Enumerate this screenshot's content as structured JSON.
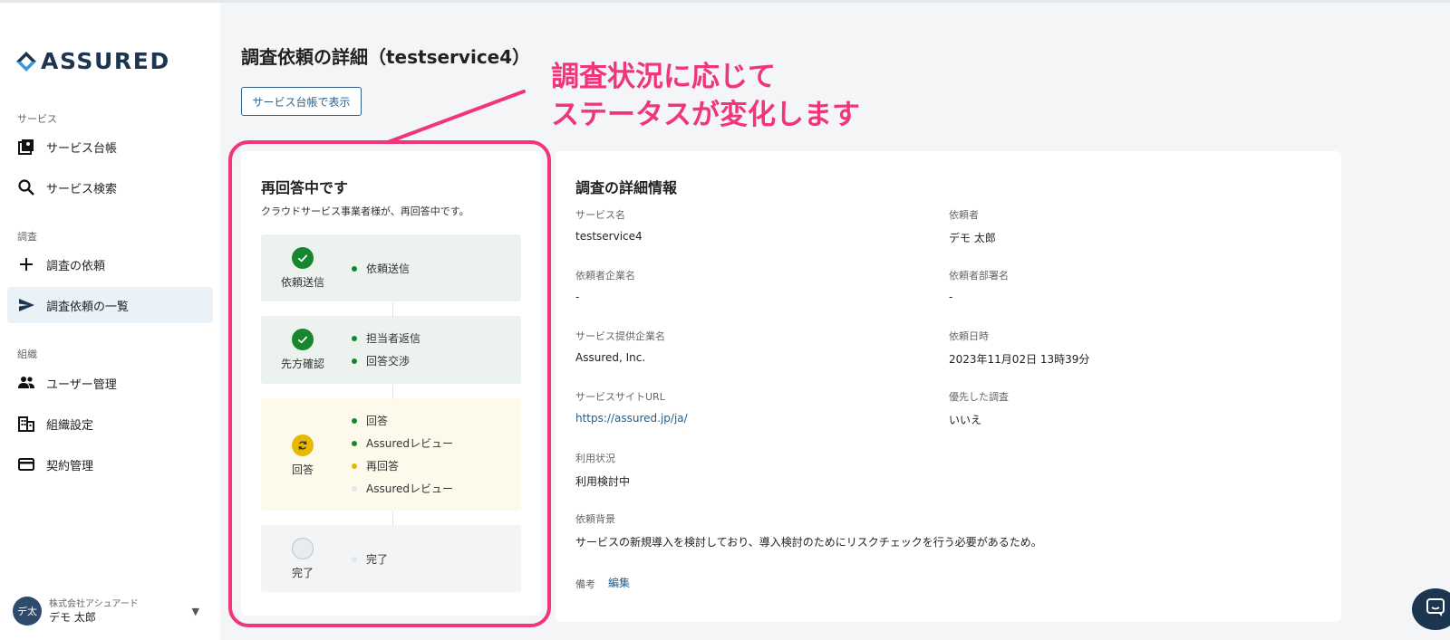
{
  "brand": {
    "logo_text": "ASSURED",
    "color": "#1c3551"
  },
  "sidebar": {
    "section_service": "サービス",
    "section_survey": "調査",
    "section_org": "組織",
    "items": [
      {
        "label": "サービス台帳",
        "icon": "service-ledger-icon"
      },
      {
        "label": "サービス検索",
        "icon": "search-icon"
      },
      {
        "label": "調査の依頼",
        "icon": "plus-icon"
      },
      {
        "label": "調査依頼の一覧",
        "icon": "send-icon",
        "active": true
      },
      {
        "label": "ユーザー管理",
        "icon": "users-icon"
      },
      {
        "label": "組織設定",
        "icon": "building-icon"
      },
      {
        "label": "契約管理",
        "icon": "credit-card-icon"
      }
    ],
    "user": {
      "avatar": "デ太",
      "company": "株式会社アシュアード",
      "name": "デモ 太郎"
    }
  },
  "main": {
    "title": "調査依頼の詳細（testservice4）",
    "ledger_button": "サービス台帳で表示"
  },
  "annotation": {
    "line1": "調査状況に応じて",
    "line2": "ステータスが変化します",
    "color": "#f0357a"
  },
  "status": {
    "title": "再回答中です",
    "description": "クラウドサービス事業者様が、再回答中です。",
    "stages": [
      {
        "label": "依頼送信",
        "state": "done",
        "steps": [
          {
            "text": "依頼送信",
            "state": "done"
          }
        ]
      },
      {
        "label": "先方確認",
        "state": "done",
        "steps": [
          {
            "text": "担当者返信",
            "state": "done"
          },
          {
            "text": "回答交渉",
            "state": "done"
          }
        ]
      },
      {
        "label": "回答",
        "state": "in-progress",
        "steps": [
          {
            "text": "回答",
            "state": "done"
          },
          {
            "text": "Assuredレビュー",
            "state": "done"
          },
          {
            "text": "再回答",
            "state": "current"
          },
          {
            "text": "Assuredレビュー",
            "state": "pending"
          }
        ]
      },
      {
        "label": "完了",
        "state": "pending",
        "steps": [
          {
            "text": "完了",
            "state": "pending"
          }
        ]
      }
    ]
  },
  "details": {
    "title": "調査の詳細情報",
    "service_name_label": "サービス名",
    "service_name": "testservice4",
    "requester_label": "依頼者",
    "requester": "デモ 太郎",
    "requester_company_label": "依頼者企業名",
    "requester_company": "-",
    "requester_dept_label": "依頼者部署名",
    "requester_dept": "-",
    "provider_label": "サービス提供企業名",
    "provider": "Assured, Inc.",
    "request_date_label": "依頼日時",
    "request_date": "2023年11月02日 13時39分",
    "site_url_label": "サービスサイトURL",
    "site_url": "https://assured.jp/ja/",
    "priority_label": "優先した調査",
    "priority": "いいえ",
    "usage_label": "利用状況",
    "usage": "利用検討中",
    "background_label": "依頼背景",
    "background": "サービスの新規導入を検討しており、導入検討のためにリスクチェックを行う必要があるため。",
    "notes_label": "備考",
    "edit_link": "編集"
  },
  "colors": {
    "done": "#16872f",
    "current": "#e6b800",
    "pending": "#e4e7e9",
    "link": "#1f5d8c"
  }
}
